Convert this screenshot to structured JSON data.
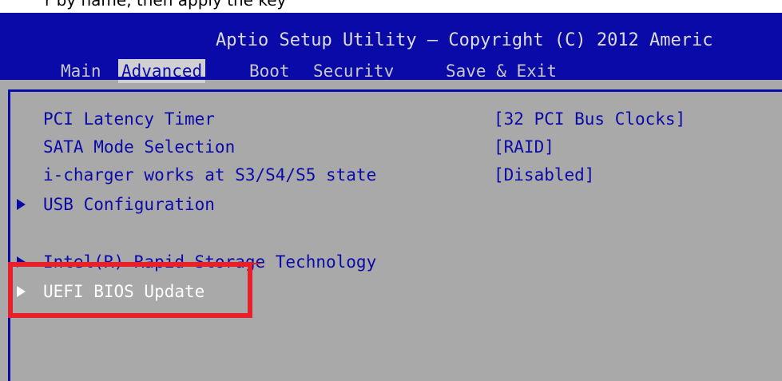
{
  "top_strip": {
    "text": "r by name, then apply the key"
  },
  "header": {
    "title": "Aptio Setup Utility – Copyright (C) 2012 Americ",
    "tabs": [
      {
        "label": "Main",
        "active": false
      },
      {
        "label": "Advanced",
        "active": true
      },
      {
        "label": "Boot",
        "active": false
      },
      {
        "label": "Security",
        "active": false
      },
      {
        "label": "Save & Exit",
        "active": false
      }
    ]
  },
  "settings": [
    {
      "label": "PCI Latency Timer",
      "value": "[32 PCI Bus Clocks]",
      "submenu": false
    },
    {
      "label": "SATA Mode Selection",
      "value": "[RAID]",
      "submenu": false
    },
    {
      "label": "i-charger works at S3/S4/S5 state",
      "value": "[Disabled]",
      "submenu": false
    },
    {
      "label": "USB Configuration",
      "value": "",
      "submenu": true
    },
    {
      "label": "Intel(R) Rapid Storage Technology",
      "value": "",
      "submenu": true
    },
    {
      "label": "UEFI BIOS Update",
      "value": "",
      "submenu": true,
      "selected": true
    }
  ],
  "colors": {
    "header_bg": "#0a0aa8",
    "panel_bg": "#a9a9a9",
    "menu_text": "#0a0aa8",
    "selected_text": "#ffffff",
    "highlight_box": "#e8202a"
  },
  "icons": {
    "submenu": "right-triangle-icon"
  }
}
